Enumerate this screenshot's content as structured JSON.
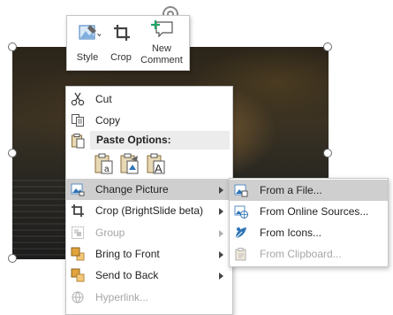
{
  "mini_toolbar": {
    "style_label": "Style",
    "crop_label": "Crop",
    "new_comment_label_line1": "New",
    "new_comment_label_line2": "Comment"
  },
  "context_menu": {
    "cut": "Cut",
    "copy": "Copy",
    "paste_options": "Paste Options:",
    "change_picture": "Change Picture",
    "crop_brightslide": "Crop (BrightSlide beta)",
    "group": "Group",
    "bring_to_front": "Bring to Front",
    "send_to_back": "Send to Back",
    "hyperlink": "Hyperlink..."
  },
  "submenu": {
    "from_file": "From a File...",
    "from_online": "From Online Sources...",
    "from_icons": "From Icons...",
    "from_clipboard": "From Clipboard..."
  },
  "colors": {
    "hover": "#cfcfcf",
    "accent_blue": "#2e75b6",
    "accent_green": "#21a366",
    "disabled_text": "#a6a6a6"
  }
}
